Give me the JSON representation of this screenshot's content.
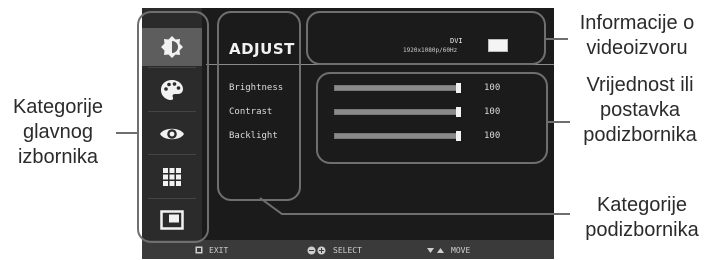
{
  "osd": {
    "header": "ADJUST",
    "source": {
      "name": "DVI",
      "resolution": "1920x1080p/60Hz"
    },
    "categories": [
      {
        "icon": "brightness-icon",
        "selected": true
      },
      {
        "icon": "palette-icon",
        "selected": false
      },
      {
        "icon": "eye-icon",
        "selected": false
      },
      {
        "icon": "grid-icon",
        "selected": false
      },
      {
        "icon": "pip-icon",
        "selected": false
      }
    ],
    "submenu": [
      {
        "label": "Brightness",
        "value": "100",
        "level": 1.0
      },
      {
        "label": "Contrast",
        "value": "100",
        "level": 1.0
      },
      {
        "label": "Backlight",
        "value": "100",
        "level": 1.0
      }
    ],
    "bottom_bar": {
      "exit": "EXIT",
      "select": "SELECT",
      "move": "MOVE"
    }
  },
  "callouts": {
    "main_categories": "Kategorije glavnog izbornika",
    "source_info": "Informacije o videoizvoru",
    "value_setting": "Vrijednost ili postavka podizbornika",
    "submenu_categories": "Kategorije podizbornika"
  }
}
